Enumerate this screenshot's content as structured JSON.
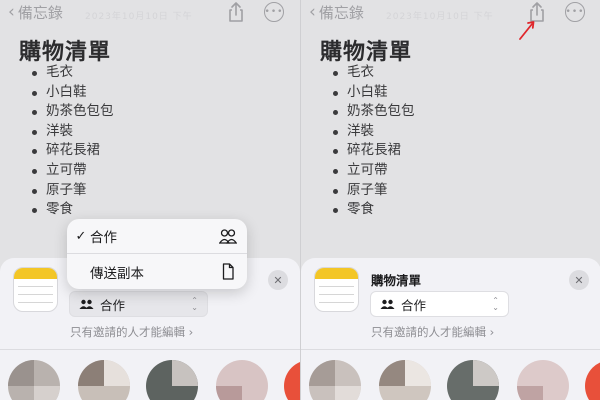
{
  "nav": {
    "back_label": "備忘錄",
    "faded_date": "2023年10月10日 下午"
  },
  "note": {
    "title": "購物清單",
    "items": [
      "毛衣",
      "小白鞋",
      "奶茶色包包",
      "洋裝",
      "碎花長裙",
      "立可帶",
      "原子筆",
      "零食"
    ]
  },
  "share_sheet": {
    "title": "購物清單",
    "collab_mode": "合作",
    "invite_text": "只有邀請的人才能編輯",
    "close_glyph": "✕"
  },
  "share_menu": {
    "items": [
      {
        "label": "合作",
        "checked": true,
        "icon": "people-icon"
      },
      {
        "label": "傳送副本",
        "checked": false,
        "icon": "document-icon"
      }
    ]
  },
  "icons": {
    "back": "chevron-left-icon",
    "share": "share-icon",
    "more": "ellipsis-circle-icon",
    "notes_app": "notes-app-icon",
    "annotation": "red-arrow-icon"
  },
  "colors": {
    "annotation_arrow": "#e0262b",
    "notes_yellow": "#f3c626",
    "avatar_accent": "#e8503a"
  }
}
